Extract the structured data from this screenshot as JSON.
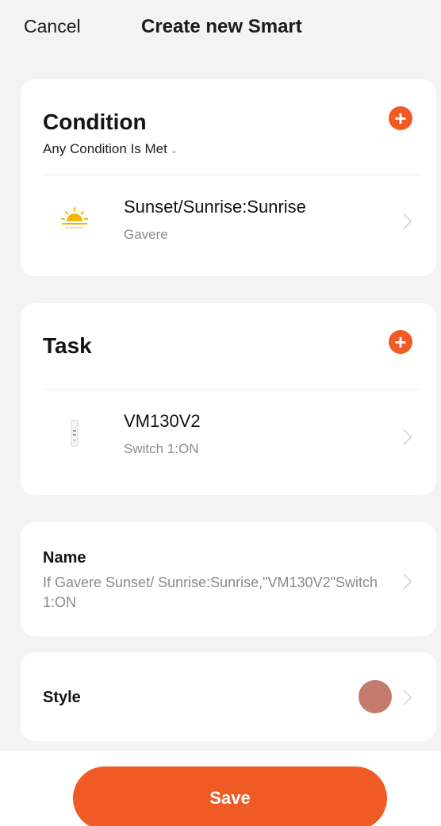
{
  "header": {
    "cancel_label": "Cancel",
    "title": "Create new Smart"
  },
  "condition": {
    "title": "Condition",
    "mode_label": "Any Condition Is Met",
    "add_icon": "plus-circle-icon",
    "items": [
      {
        "icon": "sunrise-icon",
        "title": "Sunset/Sunrise:Sunrise",
        "subtitle": "Gavere"
      }
    ]
  },
  "task": {
    "title": "Task",
    "add_icon": "plus-circle-icon",
    "items": [
      {
        "icon": "switch-device-icon",
        "title": "VM130V2",
        "subtitle": "Switch 1:ON"
      }
    ]
  },
  "name": {
    "label": "Name",
    "value": "If Gavere Sunset/ Sunrise:Sunrise,\"VM130V2\"Switch 1:ON"
  },
  "style": {
    "label": "Style",
    "color": "#c47a6c"
  },
  "footer": {
    "save_label": "Save"
  },
  "colors": {
    "accent": "#f05a24",
    "background": "#f3f3f3",
    "card": "#ffffff",
    "secondary_text": "#8a8a8a"
  }
}
